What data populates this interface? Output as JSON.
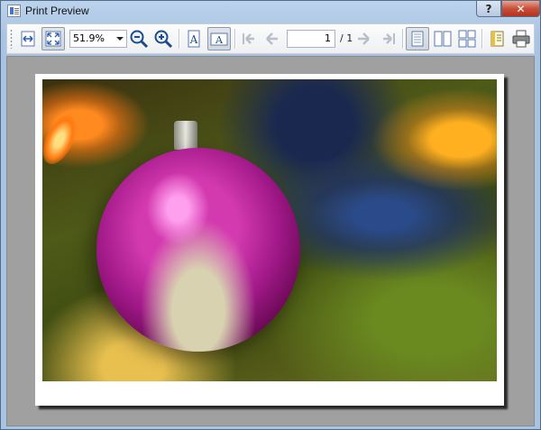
{
  "window": {
    "title": "Print Preview",
    "help_label": "?",
    "close_label": "✕"
  },
  "toolbar": {
    "zoom_value": "51.9%",
    "page_current": "1",
    "page_total": "/ 1",
    "buttons": [
      {
        "name": "fit-width-icon",
        "checked": false
      },
      {
        "name": "fit-page-icon",
        "checked": true
      },
      {
        "name": "zoom-out-icon",
        "checked": false
      },
      {
        "name": "zoom-in-icon",
        "checked": false
      },
      {
        "name": "portrait-icon",
        "checked": false
      },
      {
        "name": "landscape-icon",
        "checked": true
      },
      {
        "name": "first-page-icon",
        "checked": false
      },
      {
        "name": "previous-page-icon",
        "checked": false
      },
      {
        "name": "next-page-icon",
        "checked": false
      },
      {
        "name": "last-page-icon",
        "checked": false
      },
      {
        "name": "single-page-icon",
        "checked": true
      },
      {
        "name": "facing-pages-icon",
        "checked": false
      },
      {
        "name": "overview-icon",
        "checked": false
      },
      {
        "name": "page-setup-icon",
        "checked": false
      },
      {
        "name": "print-icon",
        "checked": false
      }
    ]
  },
  "colors": {
    "preview_background": "#a0a0a0",
    "titlebar": "#bcd3ec",
    "close_button": "#c7503a"
  }
}
